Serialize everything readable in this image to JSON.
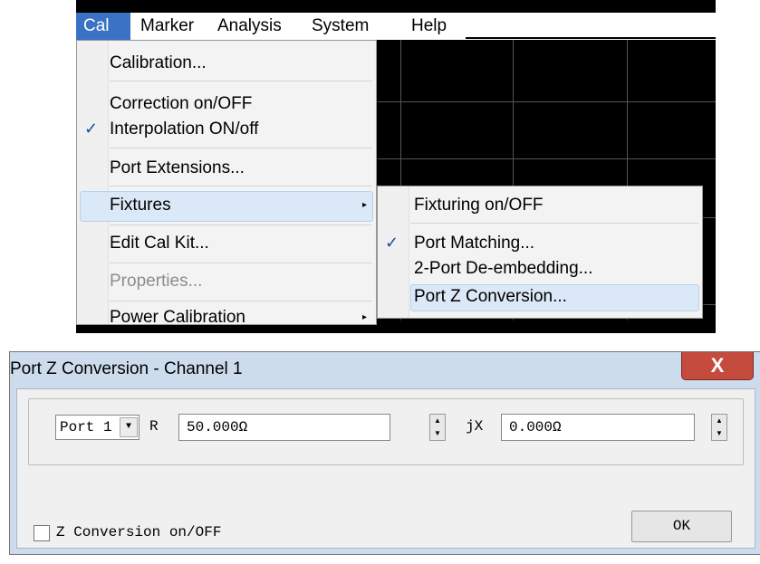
{
  "menubar": {
    "items": [
      "Cal",
      "Marker",
      "Analysis",
      "System",
      "Help"
    ],
    "active_item": "Cal"
  },
  "cal_menu": {
    "items": [
      {
        "label": "Calibration...",
        "checked": false,
        "submenu": false,
        "disabled": false,
        "highlighted": false
      },
      {
        "label": "Correction on/OFF",
        "checked": false,
        "submenu": false,
        "disabled": false,
        "highlighted": false
      },
      {
        "label": "Interpolation ON/off",
        "checked": true,
        "submenu": false,
        "disabled": false,
        "highlighted": false
      },
      {
        "label": "Port Extensions...",
        "checked": false,
        "submenu": false,
        "disabled": false,
        "highlighted": false
      },
      {
        "label": "Fixtures",
        "checked": false,
        "submenu": true,
        "disabled": false,
        "highlighted": true
      },
      {
        "label": "Edit Cal Kit...",
        "checked": false,
        "submenu": false,
        "disabled": false,
        "highlighted": false
      },
      {
        "label": "Properties...",
        "checked": false,
        "submenu": false,
        "disabled": true,
        "highlighted": false
      },
      {
        "label": "Power Calibration",
        "checked": false,
        "submenu": true,
        "disabled": false,
        "highlighted": false
      }
    ],
    "check_glyph": "✓",
    "submenu_arrow": "▸"
  },
  "fixtures_menu": {
    "items": [
      {
        "label": "Fixturing on/OFF",
        "checked": false,
        "highlighted": false
      },
      {
        "label": "Port Matching...",
        "checked": true,
        "highlighted": false
      },
      {
        "label": "2-Port De-embedding...",
        "checked": false,
        "highlighted": false
      },
      {
        "label": "Port Z Conversion...",
        "checked": false,
        "highlighted": true
      }
    ]
  },
  "dialog": {
    "title": "Port Z Conversion - Channel 1",
    "close_glyph": "X",
    "port_select": {
      "value": "Port 1",
      "arrow": "▼"
    },
    "r_label": "R",
    "r_value": "50.000Ω",
    "jx_label": "jX",
    "jx_value": "0.000Ω",
    "z_conversion_label": "Z Conversion on/OFF",
    "z_conversion_checked": false,
    "ok_label": "OK",
    "spin_up": "▲",
    "spin_down": "▼"
  },
  "colors": {
    "menu_highlight": "#dbe8f7",
    "active_menubar": "#3a73c6",
    "close_button": "#c44b3e",
    "dialog_frame": "#ccdced",
    "check_color": "#1f4f9e"
  }
}
